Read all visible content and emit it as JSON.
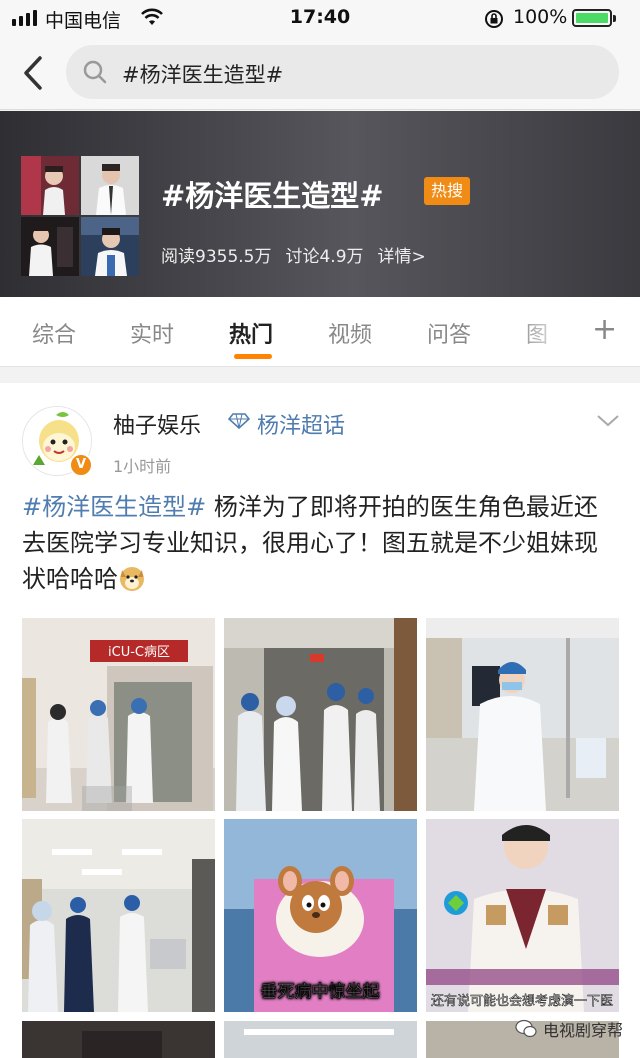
{
  "status": {
    "carrier": "中国电信",
    "time": "17:40",
    "battery": "100%"
  },
  "search": {
    "query": "#杨洋医生造型#"
  },
  "topic": {
    "title": "#杨洋医生造型#",
    "badge": "热搜",
    "reads": "阅读9355.5万",
    "discussions": "讨论4.9万",
    "details": "详情>"
  },
  "tabs": [
    {
      "label": "综合"
    },
    {
      "label": "实时"
    },
    {
      "label": "热门"
    },
    {
      "label": "视频"
    },
    {
      "label": "问答"
    },
    {
      "label": "图"
    }
  ],
  "post": {
    "author": "柚子娱乐",
    "super_topic": "杨洋超话",
    "time": "1小时前",
    "hashtag": "#杨洋医生造型#",
    "body": " 杨洋为了即将开拍的医生角色最近还去医院学习专业知识，很用心了！图五就是不少姐妹现状哈哈哈",
    "images": [
      {
        "name": "icu-corridor-photo",
        "sign_text": "iCU-C病区"
      },
      {
        "name": "doorway-photo"
      },
      {
        "name": "ward-doctor-photo"
      },
      {
        "name": "hospital-hall-photo"
      },
      {
        "name": "cartoon-mouse-photo",
        "caption": "垂死病中惊坐起"
      },
      {
        "name": "interview-photo",
        "caption": "还有说可能也会想考虑演一下医"
      }
    ]
  },
  "watermark": {
    "text": "电视剧穿帮"
  }
}
